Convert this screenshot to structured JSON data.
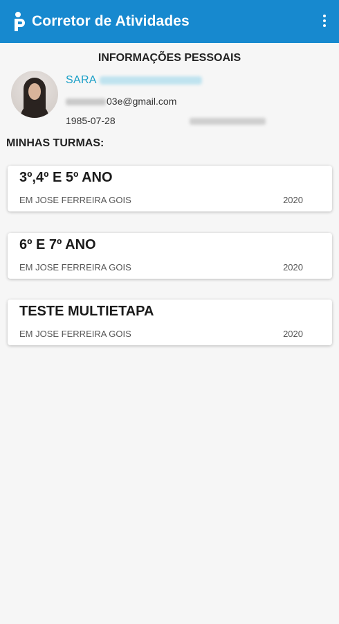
{
  "app": {
    "title": "Corretor de Atividades",
    "accent_color": "#1789cf",
    "logo_icon": "person-logo-icon",
    "menu_icon": "more-vert-icon"
  },
  "profile": {
    "section_title": "INFORMAÇÕES PESSOAIS",
    "name_visible": "SARA",
    "email_visible": "03e@gmail.com",
    "birth_date": "1985-07-28"
  },
  "classes": {
    "title": "MINHAS TURMAS:",
    "items": [
      {
        "name": "3º,4º E 5º ANO",
        "school": "EM JOSE FERREIRA GOIS",
        "year": "2020"
      },
      {
        "name": "6º E 7º ANO",
        "school": "EM JOSE FERREIRA GOIS",
        "year": "2020"
      },
      {
        "name": "TESTE MULTIETAPA",
        "school": "EM JOSE FERREIRA GOIS",
        "year": "2020"
      }
    ]
  }
}
